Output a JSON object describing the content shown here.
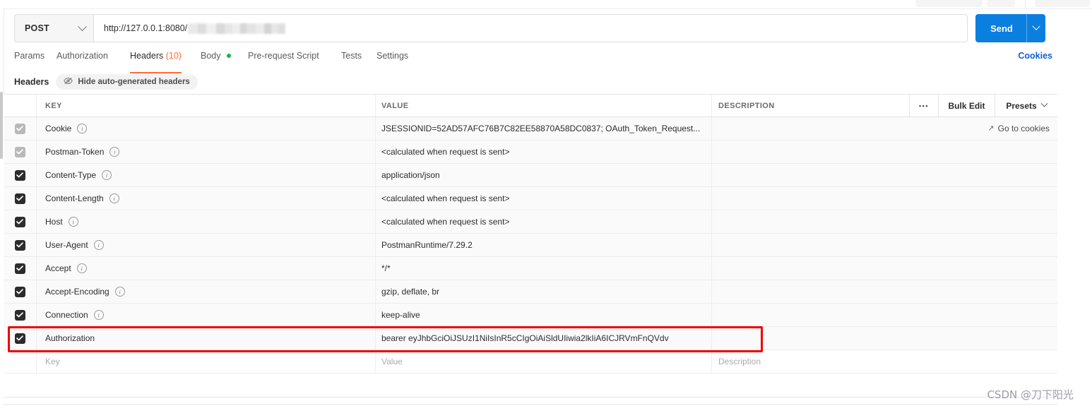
{
  "request_bar": {
    "method": "POST",
    "method_icon": "chevron-down-icon",
    "url_prefix": "http://127.0.0.1:8080/",
    "url_redacted_note": "",
    "send_label": "Send",
    "send_caret_icon": "chevron-down-icon"
  },
  "tabs": [
    {
      "label": "Params",
      "active": false
    },
    {
      "label": "Authorization",
      "active": false
    },
    {
      "label": "Headers",
      "count": "(10)",
      "active": true
    },
    {
      "label": "Body",
      "active": false,
      "dot": "green"
    },
    {
      "label": "Pre-request Script",
      "active": false
    },
    {
      "label": "Tests",
      "active": false
    },
    {
      "label": "Settings",
      "active": false
    }
  ],
  "cookies_link": "Cookies",
  "subheader": {
    "title": "Headers",
    "hide_pill_label": "Hide auto-generated headers",
    "hide_pill_icon": "eye-slash-icon"
  },
  "table": {
    "columns": {
      "key": "KEY",
      "value": "VALUE",
      "description": "DESCRIPTION"
    },
    "tools": {
      "more_icon": "ellipsis-icon",
      "bulk_edit": "Bulk Edit",
      "presets": "Presets",
      "presets_icon": "chevron-down-icon"
    },
    "go_to_cookies": {
      "label": "Go to cookies",
      "icon": "arrow-up-right-icon"
    },
    "rows": [
      {
        "checked": true,
        "checkbox_state": "auto-generated",
        "key": "Cookie",
        "info_icon": "info-icon",
        "value": "JSESSIONID=52AD57AFC76B7C82EE58870A58DC0837; OAuth_Token_Request...",
        "description": "",
        "highlighted": false
      },
      {
        "checked": true,
        "checkbox_state": "auto-generated",
        "key": "Postman-Token",
        "info_icon": "info-icon",
        "value": "<calculated when request is sent>",
        "description": "",
        "highlighted": false
      },
      {
        "checked": true,
        "checkbox_state": "enabled",
        "key": "Content-Type",
        "info_icon": "info-icon",
        "value": "application/json",
        "description": "",
        "highlighted": false
      },
      {
        "checked": true,
        "checkbox_state": "enabled",
        "key": "Content-Length",
        "info_icon": "info-icon",
        "value": "<calculated when request is sent>",
        "description": "",
        "highlighted": false
      },
      {
        "checked": true,
        "checkbox_state": "enabled",
        "key": "Host",
        "info_icon": "info-icon",
        "value": "<calculated when request is sent>",
        "description": "",
        "highlighted": false
      },
      {
        "checked": true,
        "checkbox_state": "enabled",
        "key": "User-Agent",
        "info_icon": "info-icon",
        "value": "PostmanRuntime/7.29.2",
        "description": "",
        "highlighted": false
      },
      {
        "checked": true,
        "checkbox_state": "enabled",
        "key": "Accept",
        "info_icon": "info-icon",
        "value": "*/*",
        "description": "",
        "highlighted": false
      },
      {
        "checked": true,
        "checkbox_state": "enabled",
        "key": "Accept-Encoding",
        "info_icon": "info-icon",
        "value": "gzip, deflate, br",
        "description": "",
        "highlighted": false
      },
      {
        "checked": true,
        "checkbox_state": "enabled",
        "key": "Connection",
        "info_icon": "info-icon",
        "value": "keep-alive",
        "description": "",
        "highlighted": false
      },
      {
        "checked": true,
        "checkbox_state": "enabled",
        "key": "Authorization",
        "info_icon": "",
        "value": "bearer eyJhbGciOiJSUzI1NiIsInR5cCIgOiAiSldUIiwia2lkIiA6ICJRVmFnQVdv",
        "description": "",
        "highlighted": true
      }
    ],
    "new_row_placeholders": {
      "key": "Key",
      "value": "Value",
      "description": "Description"
    }
  },
  "annotation": {
    "highlight_color": "#ee0000"
  },
  "watermark": "CSDN @刀下阳光"
}
